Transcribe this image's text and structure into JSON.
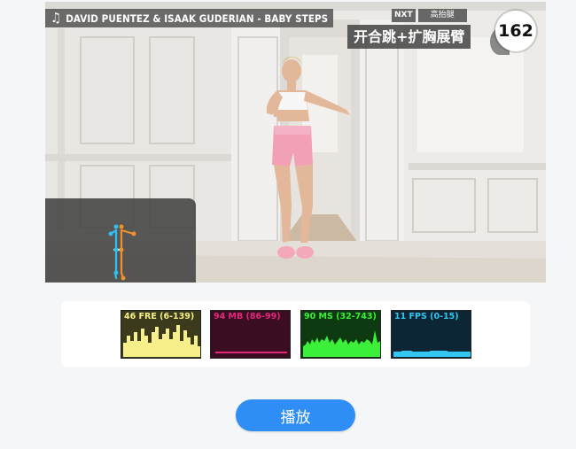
{
  "video": {
    "music_title": "DAVID PUENTEZ & ISAAK GUDERIAN - BABY STEPS",
    "next_tag": "NXT",
    "next_exercise": "高抬腿",
    "exercise_title": "开合跳+扩胸展臂",
    "rep_count": "162"
  },
  "stats": [
    {
      "label": "46 FRE (6-139)",
      "color": "#f7f08a",
      "bg": "#3b3a1c"
    },
    {
      "label": "94 MB (86-99)",
      "color": "#e0287a",
      "bg": "#3a0d22"
    },
    {
      "label": "90 MS (32-743)",
      "color": "#3cf03a",
      "bg": "#0d3a10"
    },
    {
      "label": "11 FPS (0-15)",
      "color": "#34c6f2",
      "bg": "#0d2636"
    }
  ],
  "controls": {
    "play_label": "播放"
  },
  "colors": {
    "accent": "#2f8ef5",
    "pose_joint_left": "#2ec0ee",
    "pose_joint_right": "#f0902a"
  }
}
